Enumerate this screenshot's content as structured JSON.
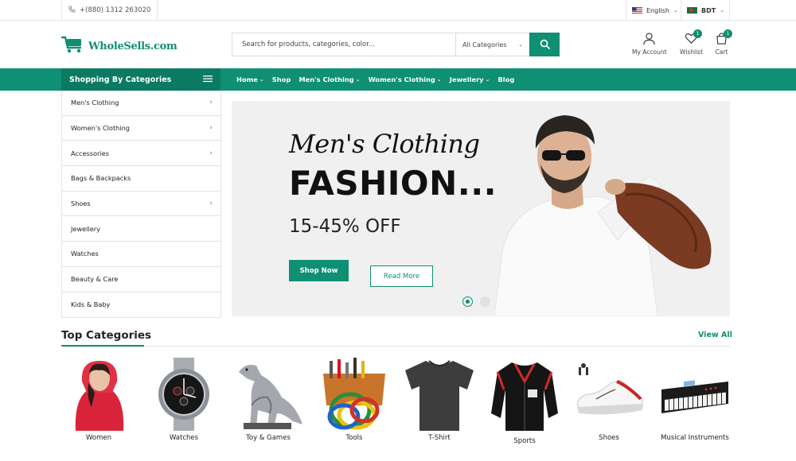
{
  "topbar": {
    "phone": "+(880) 1312 263020",
    "language": "English",
    "currency": "BDT"
  },
  "header": {
    "logo_text": "WholeSells.com",
    "search_placeholder": "Search for products, categories, color...",
    "category_select": "All Categories",
    "account_label": "My Account",
    "wishlist_label": "Wishlist",
    "wishlist_count": "1",
    "cart_label": "Cart",
    "cart_count": "1"
  },
  "nav": {
    "categories_title": "Shopping By Categories",
    "menu": [
      "Home",
      "Shop",
      "Men's Clothing",
      "Women's Clothing",
      "Jewellery",
      "Blog"
    ]
  },
  "sidebar": {
    "items": [
      {
        "label": "Men's Clothing"
      },
      {
        "label": "Women's Clothing"
      },
      {
        "label": "Accessories"
      },
      {
        "label": "Bags & Backpacks"
      },
      {
        "label": "Shoes"
      },
      {
        "label": "Jewellery"
      },
      {
        "label": "Watches"
      },
      {
        "label": "Beauty & Care"
      },
      {
        "label": "Kids & Baby"
      }
    ]
  },
  "hero": {
    "script_title": "Men's Clothing",
    "headline": "FASHION...",
    "offer": "15-45% OFF",
    "shop_button": "Shop Now",
    "read_button": "Read More"
  },
  "top_categories": {
    "title": "Top Categories",
    "view_all": "View All",
    "items": [
      {
        "label": "Women"
      },
      {
        "label": "Watches"
      },
      {
        "label": "Toy & Games"
      },
      {
        "label": "Tools"
      },
      {
        "label": "T-Shirt"
      },
      {
        "label": "Sports"
      },
      {
        "label": "Shoes"
      },
      {
        "label": "Musical Instruments"
      }
    ]
  },
  "colors": {
    "accent": "#0f8f73",
    "accent_dark": "#0a7a62"
  }
}
